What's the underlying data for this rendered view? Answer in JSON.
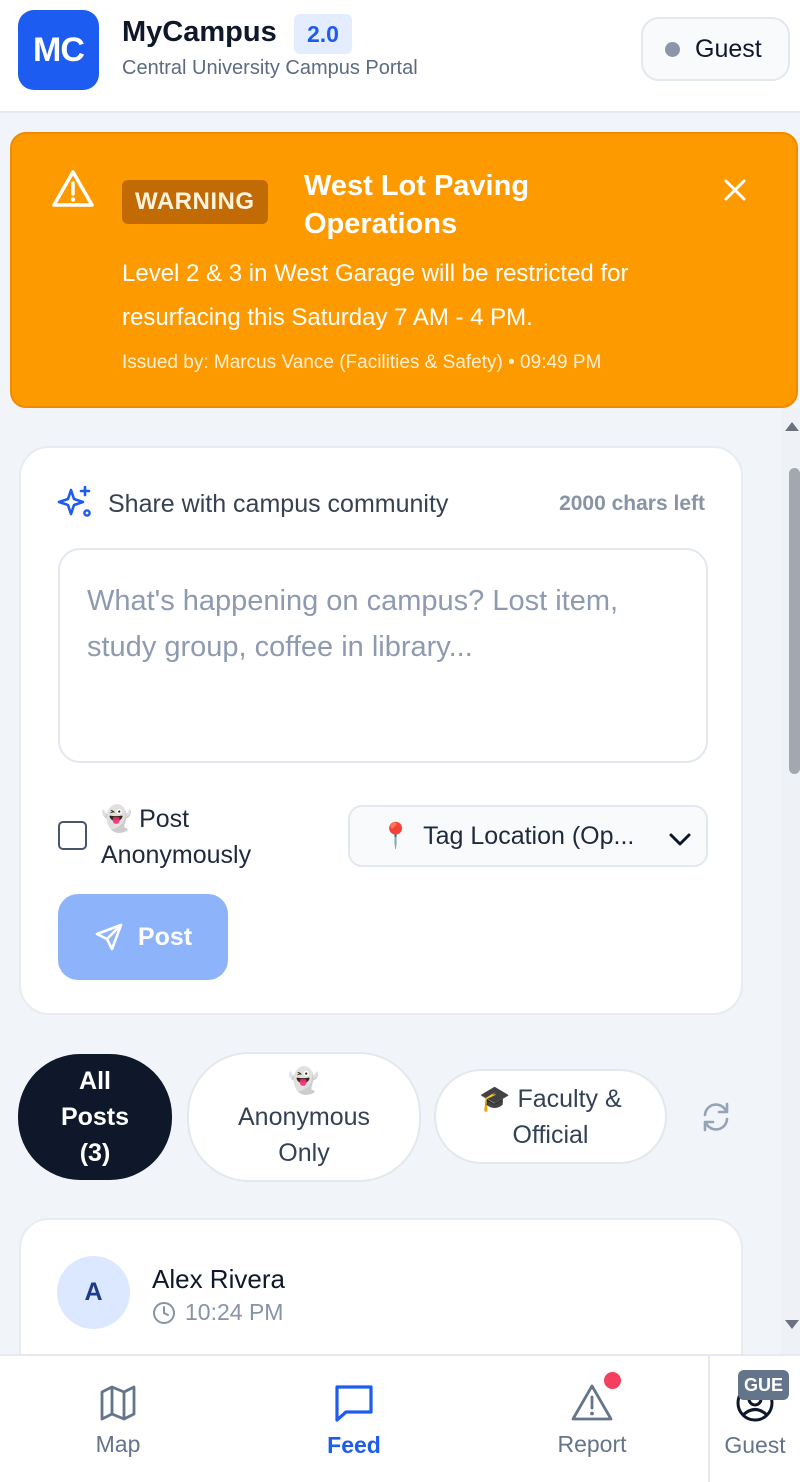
{
  "header": {
    "logo_text": "MC",
    "app_name": "MyCampus",
    "version": "2.0",
    "subtitle": "Central University Campus Portal",
    "user_label": "Guest"
  },
  "alert": {
    "badge": "WARNING",
    "title": "West Lot Paving Operations",
    "body": "Level 2 & 3 in West Garage will be restricted for resurfacing this Saturday 7 AM - 4 PM.",
    "meta": "Issued by: Marcus Vance (Facilities & Safety) • 09:49 PM",
    "color": "#fd9a00"
  },
  "compose": {
    "label": "Share with campus community",
    "chars_left": "2000 chars left",
    "placeholder": "What's happening on campus? Lost item, study group, coffee in library...",
    "anonymous_label": "Post Anonymously",
    "anonymous_emoji": "👻",
    "location_emoji": "📍",
    "location_label": "Tag Location (Op...",
    "post_button": "Post"
  },
  "filters": [
    {
      "label": "All Posts (3)",
      "active": true
    },
    {
      "emoji": "👻",
      "label": "Anonymous Only",
      "active": false
    },
    {
      "emoji": "🎓",
      "label": "Faculty & Official",
      "active": false
    }
  ],
  "posts": [
    {
      "avatar": "A",
      "author": "Alex Rivera",
      "time": "10:24 PM"
    }
  ],
  "nav": {
    "map": "Map",
    "feed": "Feed",
    "report": "Report",
    "guest": "Guest",
    "guest_badge": "GUE"
  },
  "colors": {
    "accent": "#1d5cf0",
    "warning": "#fd9a00",
    "post_button": "#8db4fb",
    "notification": "#f43f5e"
  }
}
